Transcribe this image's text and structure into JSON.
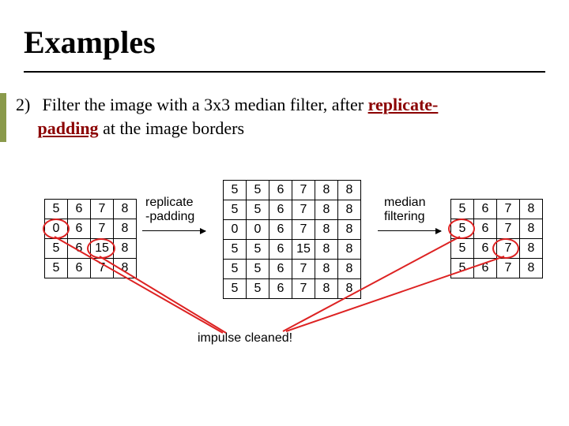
{
  "title": "Examples",
  "body": {
    "num": "2)",
    "line1_a": "Filter the image with a 3x3 median filter, after ",
    "replicate": "replicate-",
    "padding": "padding",
    "line1_b": " at the image borders"
  },
  "labels": {
    "replicate1": "replicate",
    "replicate2": "-padding",
    "median1": "median",
    "median2": "filtering",
    "impulse": "impulse cleaned!"
  },
  "tableA": [
    [
      "5",
      "6",
      "7",
      "8"
    ],
    [
      "0",
      "6",
      "7",
      "8"
    ],
    [
      "5",
      "6",
      "15",
      "8"
    ],
    [
      "5",
      "6",
      "7",
      "8"
    ]
  ],
  "tableB": [
    [
      "5",
      "5",
      "6",
      "7",
      "8",
      "8"
    ],
    [
      "5",
      "5",
      "6",
      "7",
      "8",
      "8"
    ],
    [
      "0",
      "0",
      "6",
      "7",
      "8",
      "8"
    ],
    [
      "5",
      "5",
      "6",
      "15",
      "8",
      "8"
    ],
    [
      "5",
      "5",
      "6",
      "7",
      "8",
      "8"
    ],
    [
      "5",
      "5",
      "6",
      "7",
      "8",
      "8"
    ]
  ],
  "tableC": [
    [
      "5",
      "6",
      "7",
      "8"
    ],
    [
      "5",
      "6",
      "7",
      "8"
    ],
    [
      "5",
      "6",
      "7",
      "8"
    ],
    [
      "5",
      "6",
      "7",
      "8"
    ]
  ]
}
